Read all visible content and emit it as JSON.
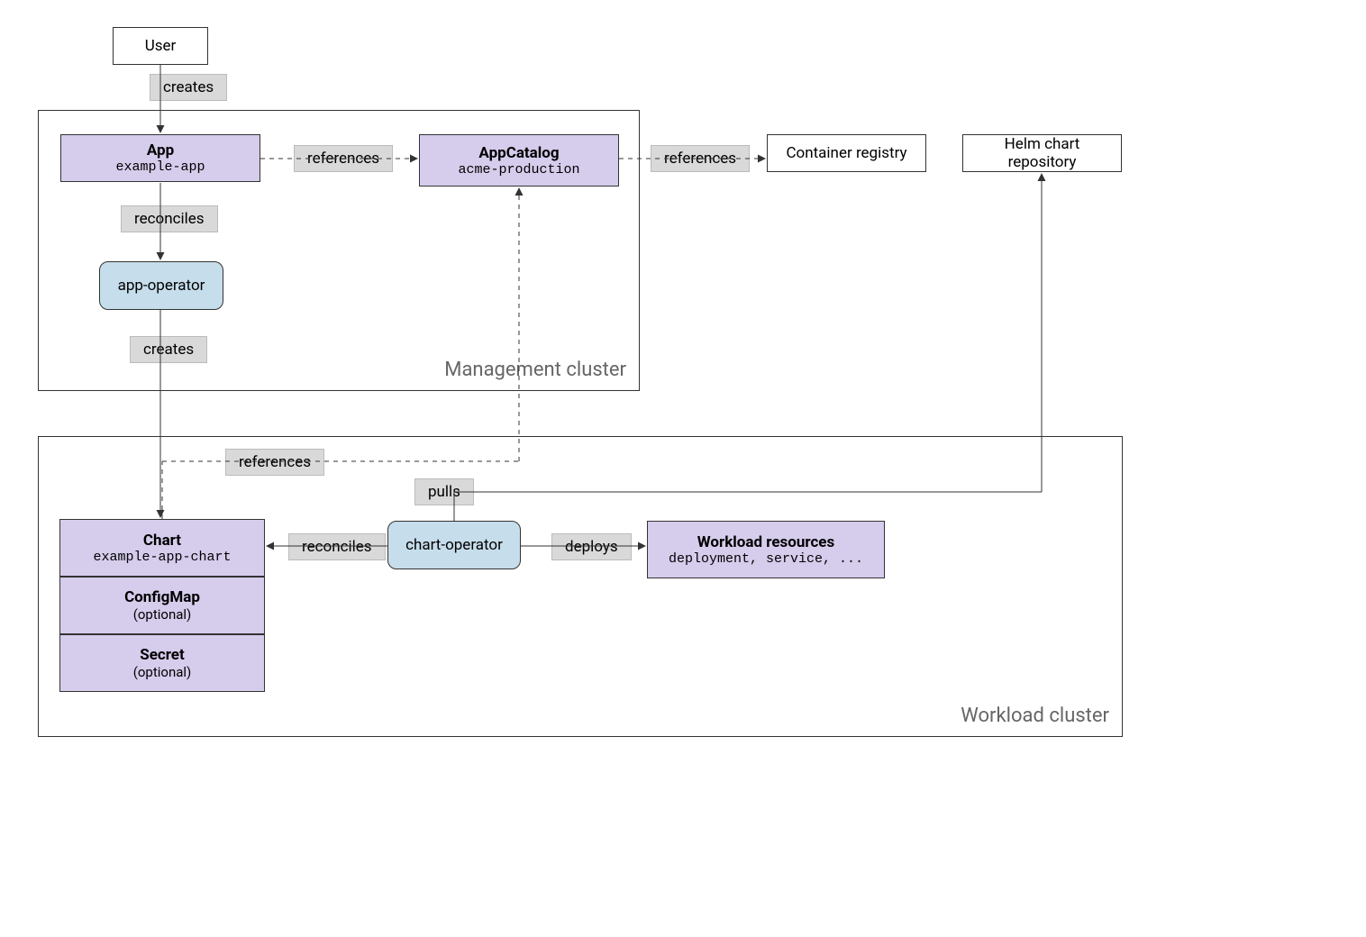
{
  "user_box": "User",
  "container_registry": "Container registry",
  "helm_repo": "Helm chart repository",
  "app": {
    "title": "App",
    "sub": "example-app"
  },
  "catalog": {
    "title": "AppCatalog",
    "sub": "acme-production"
  },
  "app_operator": "app-operator",
  "chart": {
    "title": "Chart",
    "sub": "example-app-chart"
  },
  "configmap": {
    "title": "ConfigMap",
    "sub": "(optional)"
  },
  "secret": {
    "title": "Secret",
    "sub": "(optional)"
  },
  "chart_operator": "chart-operator",
  "workload": {
    "title": "Workload resources",
    "sub": "deployment, service, ..."
  },
  "labels": {
    "creates1": "creates",
    "references1": "references",
    "references2": "references",
    "reconciles1": "reconciles",
    "creates2": "creates",
    "references3": "references",
    "pulls": "pulls",
    "reconciles2": "reconciles",
    "deploys": "deploys"
  },
  "clusters": {
    "management": "Management cluster",
    "workload": "Workload cluster"
  }
}
